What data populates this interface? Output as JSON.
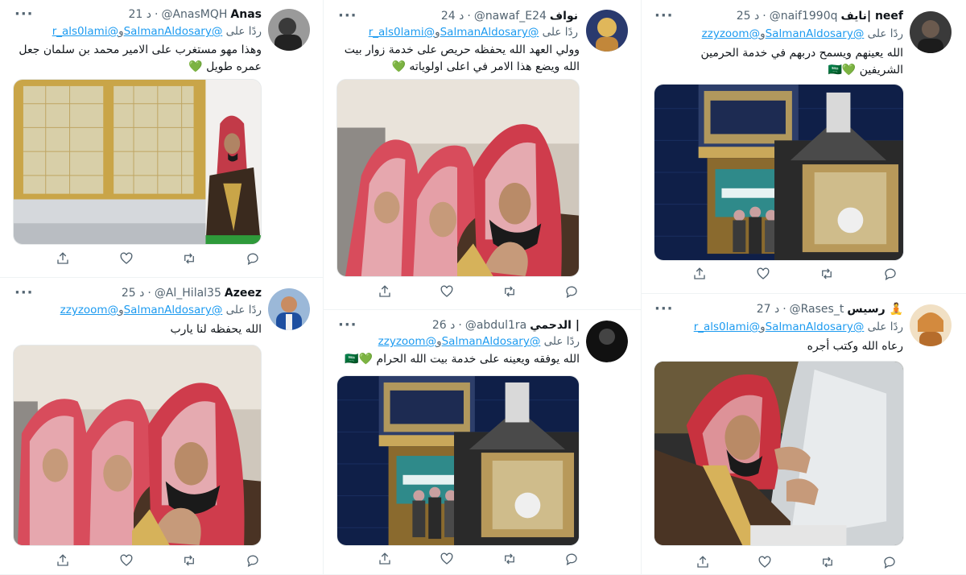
{
  "reply_prefix": "ردًا على",
  "tweets": [
    {
      "display_name": "نايف| neef",
      "handle": "@naif1990q",
      "time": "25 د",
      "mention1": "@SalmanAldosary",
      "mention_join": "و",
      "mention2": "@zzyzoom",
      "text": "الله يعينهم ويسمح دربهم في خدمة الحرمين الشريفين 💚🇸🇦",
      "media": "kaaba-door-scene",
      "avatar_color": "#2b2b2b"
    },
    {
      "display_name": "نواف",
      "handle": "@nawaf_E24",
      "time": "24 د",
      "mention1": "@SalmanAldosary",
      "mention_join": "و",
      "mention2": "@r_als0lami",
      "text": "وولي العهد الله يحفظه حريص على خدمة زوار بيت الله ويضع هذا الامر في اعلى اولوياته 💚",
      "media": "prayer-scene",
      "avatar_color": "#d7b36a"
    },
    {
      "display_name": "Anas",
      "handle": "@AnasMQH",
      "time": "21 د",
      "mention1": "@SalmanAldosary",
      "mention_join": "و",
      "mention2": "@r_als0lami",
      "text": "وهذا مهو مستغرب على الامير محمد بن سلمان جعل عمره طويل 💚",
      "media": "maqam-scene",
      "avatar_color": "#555555"
    },
    {
      "display_name": "رسيس 🧘",
      "handle": "@Rases_t",
      "time": "27 د",
      "mention1": "@SalmanAldosary",
      "mention_join": "و",
      "mention2": "@r_als0lami",
      "text": "رعاه الله وكتب أجره",
      "media": "maqam-touch-scene",
      "avatar_color": "#e8c9a0"
    },
    {
      "display_name": "الدحمي |",
      "handle": "@abdul1ra",
      "time": "26 د",
      "mention1": "@SalmanAldosary",
      "mention_join": "و",
      "mention2": "@zzyzoom",
      "text": "الله يوفقه ويعينه على خدمة بيت الله الحرام 💚🇸🇦",
      "media": "kaaba-door-scene",
      "avatar_color": "#111111"
    },
    {
      "display_name": "Azeez",
      "handle": "@Al_Hilal35",
      "time": "25 د",
      "mention1": "@SalmanAldosary",
      "mention_join": "و",
      "mention2": "@zzyzoom",
      "text": "الله يحفظه لنا يارب",
      "media": "prayer-scene",
      "avatar_color": "#1e4fa0"
    }
  ]
}
